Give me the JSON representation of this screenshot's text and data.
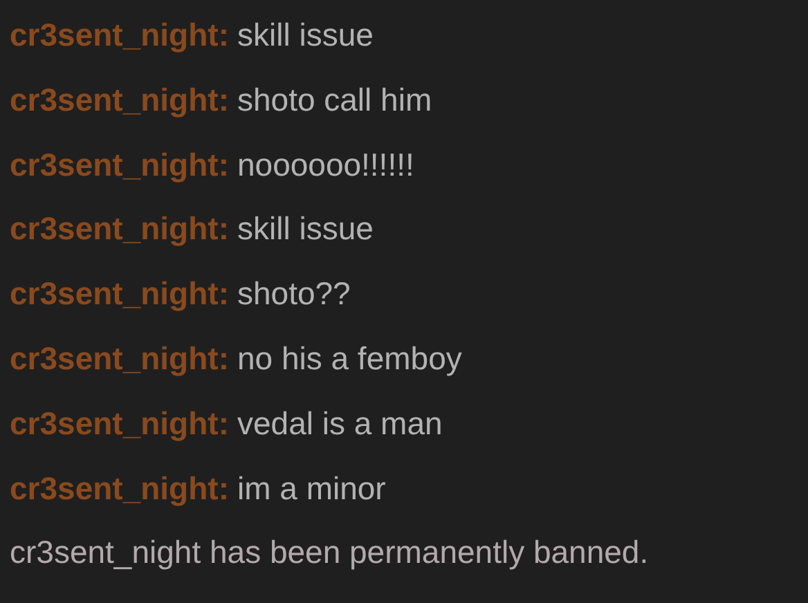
{
  "messages": [
    {
      "user": "cr3sent_night:",
      "text": "skill issue"
    },
    {
      "user": "cr3sent_night:",
      "text": "shoto call him"
    },
    {
      "user": "cr3sent_night:",
      "text": "noooooo!!!!!!"
    },
    {
      "user": "cr3sent_night:",
      "text": "skill issue"
    },
    {
      "user": "cr3sent_night:",
      "text": "shoto??"
    },
    {
      "user": "cr3sent_night:",
      "text": "no his a femboy"
    },
    {
      "user": "cr3sent_night:",
      "text": "vedal is a man"
    },
    {
      "user": "cr3sent_night:",
      "text": "im a minor"
    }
  ],
  "notice": "cr3sent_night has been permanently banned."
}
